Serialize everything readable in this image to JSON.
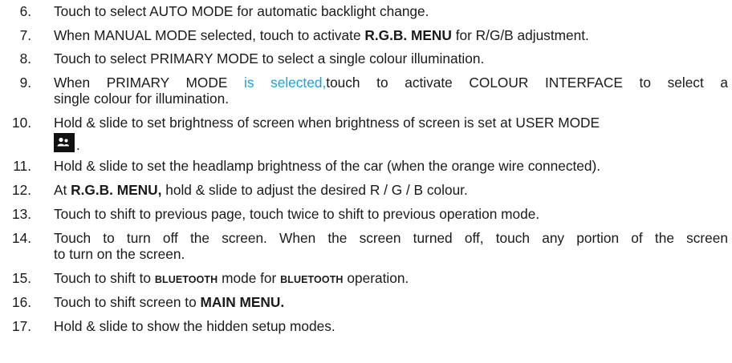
{
  "items": [
    {
      "num": "6.",
      "text": "Touch to select AUTO MODE for automatic backlight change."
    },
    {
      "num": "7.",
      "pre": "When MANUAL MODE selected, touch to activate ",
      "bold": "R.G.B. MENU",
      "post": " for R/G/B adjustment."
    },
    {
      "num": "8.",
      "text": "Touch to select PRIMARY MODE to select a single colour illumination."
    },
    {
      "num": "9.",
      "pre": "When PRIMARY MODE ",
      "highlight": "is selected,",
      "post": "touch to activate COLOUR INTERFACE to select a",
      "line2": "single colour for illumination."
    },
    {
      "num": "10.",
      "text": "Hold & slide to set brightness of screen when brightness of screen is set at USER MODE",
      "icon": "user-mode-icon",
      "after_icon": "."
    },
    {
      "num": "11.",
      "text": "Hold & slide to set the headlamp brightness of the car (when the orange wire connected)."
    },
    {
      "num": "12.",
      "pre": "At ",
      "bold": "R.G.B. MENU,",
      "post": " hold & slide to adjust the desired R / G / B colour."
    },
    {
      "num": "13.",
      "text": "Touch to shift to previous page, touch twice to shift to previous operation mode."
    },
    {
      "num": "14.",
      "text": "Touch to turn off the screen. When the screen turned off, touch any portion of the screen",
      "line2": "to turn on the screen."
    },
    {
      "num": "15.",
      "pre": "Touch to shift to ",
      "word1": "BLUETOOTH",
      "mid": " mode for ",
      "word2": "BLUETOOTH",
      "post": " operation."
    },
    {
      "num": "16.",
      "pre": "Touch to shift screen to ",
      "bold": "MAIN MENU."
    },
    {
      "num": "17.",
      "text": "Hold & slide to show the hidden setup modes."
    }
  ]
}
